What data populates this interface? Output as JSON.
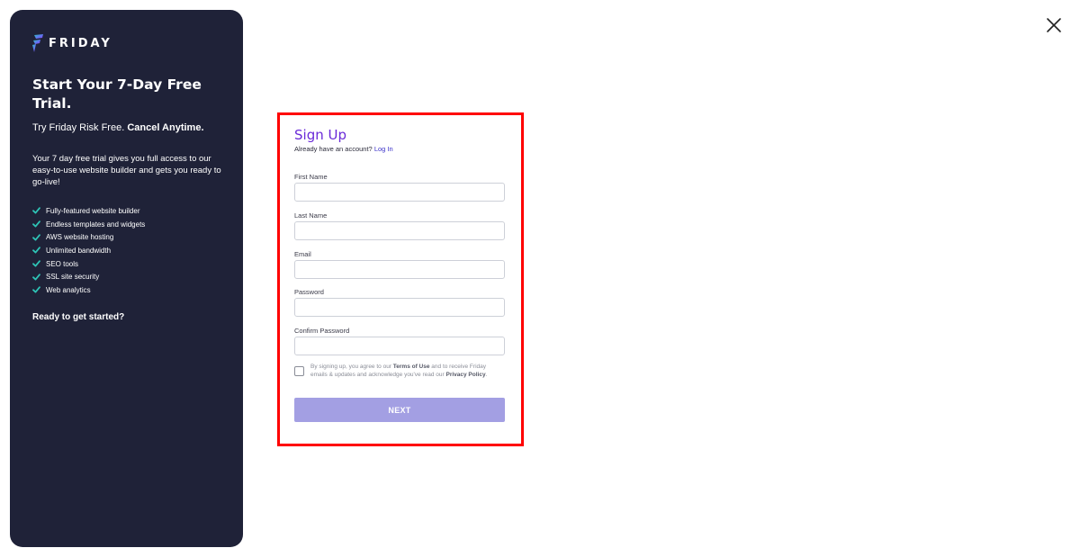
{
  "sidebar": {
    "brand": "FRIDAY",
    "headline": "Start Your 7-Day Free Trial.",
    "tagline_prefix": "Try Friday Risk Free. ",
    "tagline_emphasis": "Cancel Anytime.",
    "intro": "Your 7 day free trial gives you full access to our easy-to-use website builder and gets you ready to go-live!",
    "features": [
      "Fully-featured website builder",
      "Endless templates and widgets",
      "AWS website hosting",
      "Unlimited bandwidth",
      "SEO tools",
      "SSL site security",
      "Web analytics"
    ],
    "cta": "Ready to get started?"
  },
  "form": {
    "title": "Sign Up",
    "account_prompt": "Already have an account? ",
    "login_link": "Log In",
    "fields": [
      {
        "label": "First Name",
        "value": ""
      },
      {
        "label": "Last Name",
        "value": ""
      },
      {
        "label": "Email",
        "value": ""
      },
      {
        "label": "Password",
        "value": ""
      },
      {
        "label": "Confirm Password",
        "value": ""
      }
    ],
    "agreement": {
      "checked": false,
      "text_1": "By signing up, you agree to our ",
      "terms_link": "Terms of Use",
      "text_2": " and to receive Friday emails & updates and acknowledge you've read our ",
      "privacy_link": "Privacy Policy",
      "text_3": "."
    },
    "next_label": "NEXT"
  },
  "icons": {
    "close": "close-icon",
    "check": "check-icon",
    "logo": "friday-logo-icon"
  },
  "colors": {
    "sidebar_bg": "#1f2238",
    "check": "#2ec4b6",
    "title": "#6a2ad8",
    "link": "#3b32c9",
    "button": "#a39fe3",
    "highlight_border": "#ff0000"
  }
}
